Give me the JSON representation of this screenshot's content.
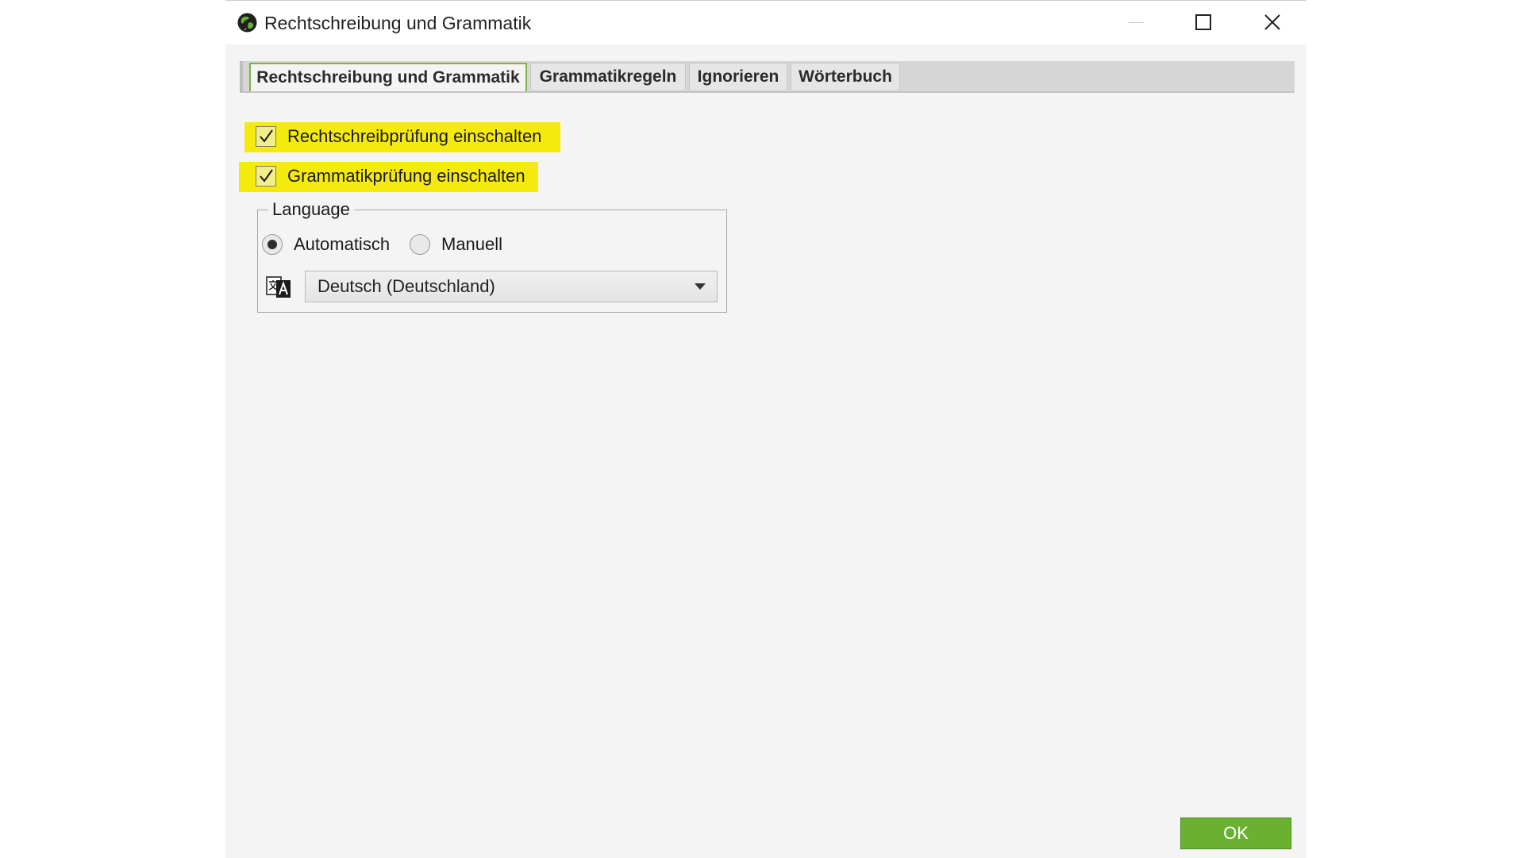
{
  "window": {
    "title": "Rechtschreibung und Grammatik",
    "icon": "globe-logo-icon",
    "controls": [
      "minimize-icon",
      "maximize-icon",
      "close-icon"
    ]
  },
  "tabs": [
    {
      "label": "Rechtschreibung und Grammatik",
      "active": true
    },
    {
      "label": "Grammatikregeln",
      "active": false
    },
    {
      "label": "Ignorieren",
      "active": false
    },
    {
      "label": "Wörterbuch",
      "active": false
    }
  ],
  "options": {
    "spellcheck": {
      "label": "Rechtschreibprüfung einschalten",
      "checked": true
    },
    "grammarcheck": {
      "label": "Grammatikprüfung einschalten",
      "checked": true
    }
  },
  "language": {
    "legend": "Language",
    "radios": [
      {
        "label": "Automatisch",
        "selected": true
      },
      {
        "label": "Manuell",
        "selected": false
      }
    ],
    "selected_value": "Deutsch (Deutschland)",
    "icon": "translate-icon"
  },
  "footer": {
    "ok_label": "OK"
  },
  "colors": {
    "highlight": "#f5ea0e",
    "ok_button": "#6ab132",
    "active_tab_border": "#7fb446"
  }
}
